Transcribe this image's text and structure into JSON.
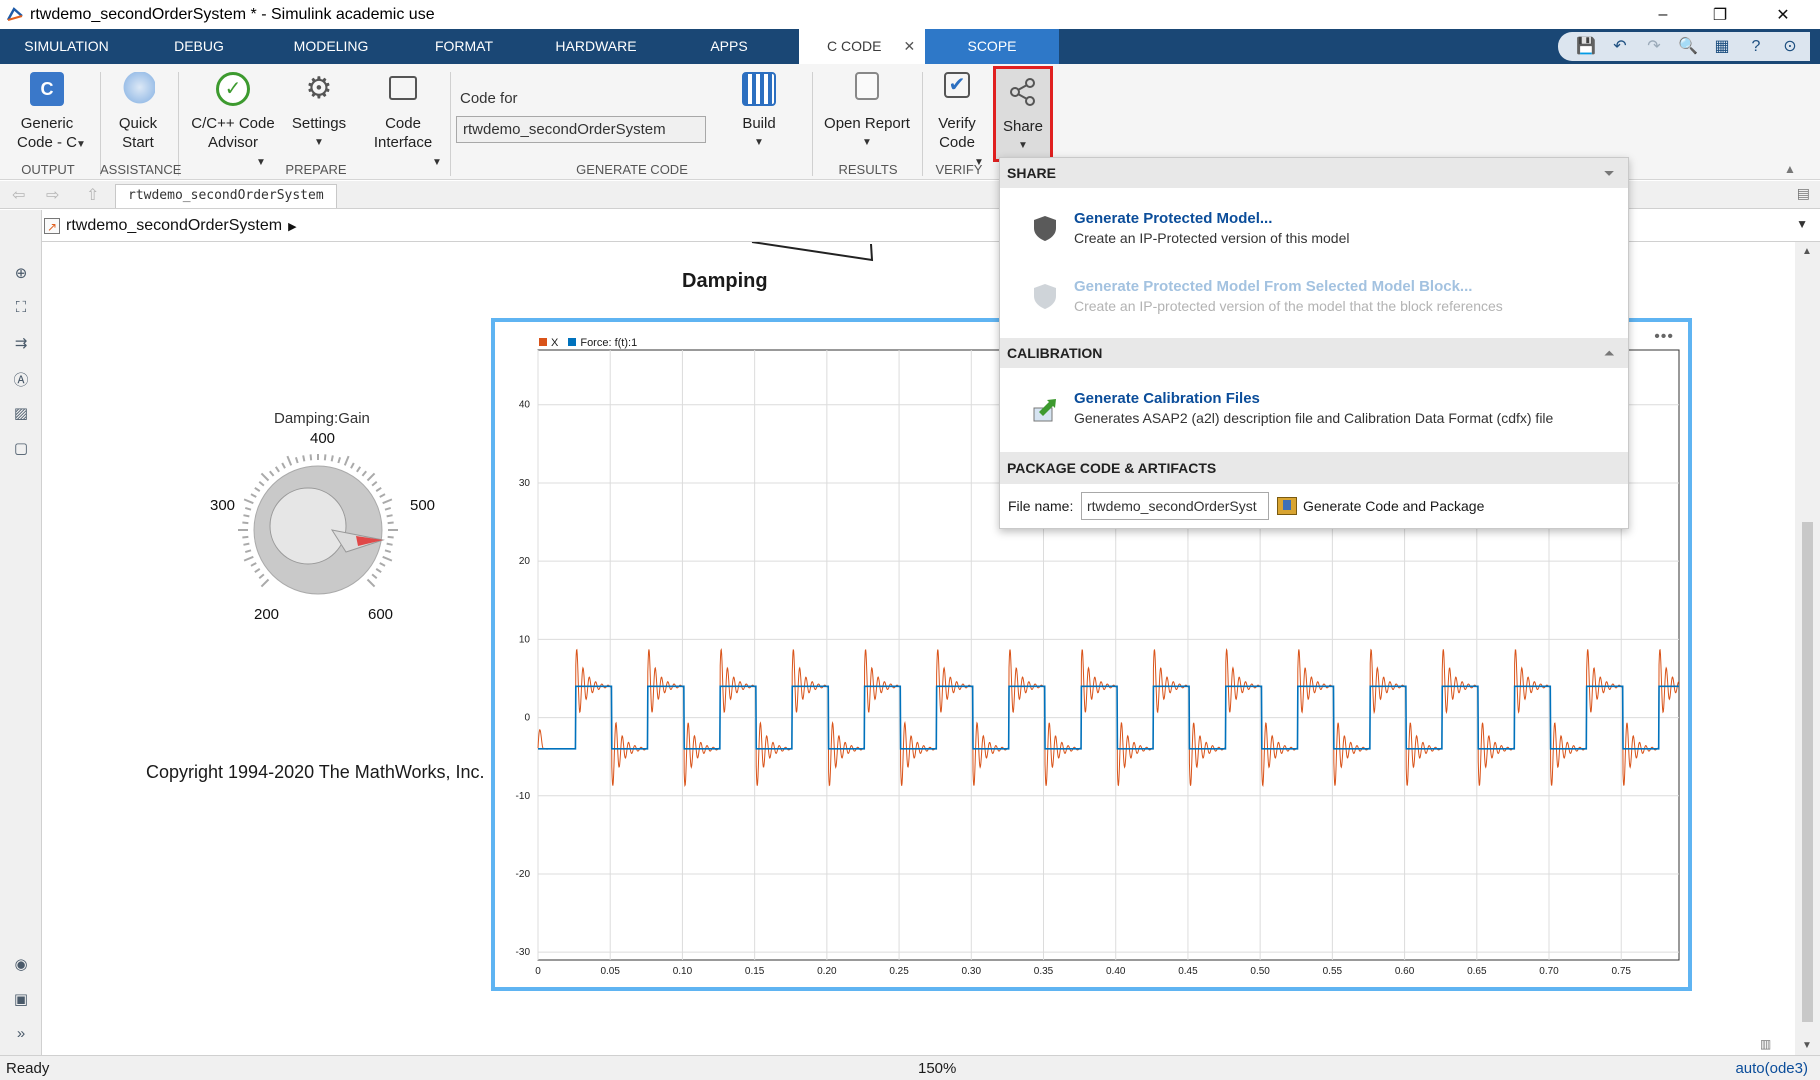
{
  "window": {
    "title": "rtwdemo_secondOrderSystem * - Simulink academic use",
    "controls": [
      "–",
      "❐",
      "✕"
    ]
  },
  "tabs": [
    {
      "label": "SIMULATION"
    },
    {
      "label": "DEBUG"
    },
    {
      "label": "MODELING"
    },
    {
      "label": "FORMAT"
    },
    {
      "label": "HARDWARE"
    },
    {
      "label": "APPS"
    },
    {
      "label": "C CODE"
    },
    {
      "label": "SCOPE"
    }
  ],
  "ribbon": {
    "generic_code": "Generic\nCode - C",
    "quick_start": "Quick\nStart",
    "advisor": "C/C++ Code\nAdvisor",
    "settings": "Settings",
    "code_interface": "Code\nInterface",
    "code_for_label": "Code for",
    "code_for_value": "rtwdemo_secondOrderSystem",
    "build": "Build",
    "open_report": "Open Report",
    "verify_code": "Verify\nCode",
    "share": "Share",
    "sections": {
      "output": "OUTPUT",
      "assistance": "ASSISTANCE",
      "prepare": "PREPARE",
      "generate_code": "GENERATE CODE",
      "results": "RESULTS",
      "verify": "VERIFY"
    }
  },
  "nav": {
    "model_tab": "rtwdemo_secondOrderSystem",
    "breadcrumb": "rtwdemo_secondOrderSystem"
  },
  "canvas": {
    "damping_label": "Damping",
    "dial_title": "Damping:Gain",
    "dial_ticks": [
      "300",
      "400",
      "500",
      "200",
      "600"
    ],
    "copyright": "Copyright 1994-2020 The MathWorks, Inc."
  },
  "share_panel": {
    "share_header": "SHARE",
    "item1_title": "Generate Protected Model...",
    "item1_desc": "Create an IP-Protected version of this model",
    "item2_title": "Generate Protected Model From Selected Model Block...",
    "item2_desc": "Create an IP-protected version of the model that the block references",
    "calibration_header": "CALIBRATION",
    "item3_title": "Generate Calibration Files",
    "item3_desc": "Generates ASAP2 (a2l) description file and Calibration Data Format (cdfx) file",
    "package_header": "PACKAGE CODE & ARTIFACTS",
    "file_name_label": "File name:",
    "file_name_value": "rtwdemo_secondOrderSyst",
    "package_button": "Generate Code and Package"
  },
  "status": {
    "left": "Ready",
    "zoom": "150%",
    "solver": "auto(ode3)"
  },
  "colors": {
    "tabstrip": "#1a4775",
    "scope_tab": "#2e78c8",
    "scope_border": "#5fb4f2",
    "series_x": "#d95319",
    "series_force": "#0072bd",
    "link": "#0b4d9a",
    "highlight": "#e02020"
  },
  "chart_data": {
    "type": "line",
    "x_ticks": [
      "0",
      "0.05",
      "0.10",
      "0.15",
      "0.20",
      "0.25",
      "0.30",
      "0.35",
      "0.40",
      "0.45",
      "0.50",
      "0.55",
      "0.60",
      "0.65",
      "0.70",
      "0.75"
    ],
    "y_ticks": [
      "40",
      "30",
      "20",
      "10",
      "0",
      "-10",
      "-20",
      "-30"
    ],
    "xlim": [
      0,
      0.79
    ],
    "ylim": [
      -31,
      47
    ],
    "grid": true,
    "legend_position": "top-left",
    "series": [
      {
        "name": "X",
        "color": "#d95319",
        "description_values": {
          "amplitude": 4,
          "overshoot_peak": 9,
          "period": 0.05
        }
      },
      {
        "name": "Force: f(t):1",
        "color": "#0072bd",
        "square_wave": {
          "amplitude": 4,
          "period": 0.05,
          "first_rise": 0.026
        }
      }
    ]
  }
}
